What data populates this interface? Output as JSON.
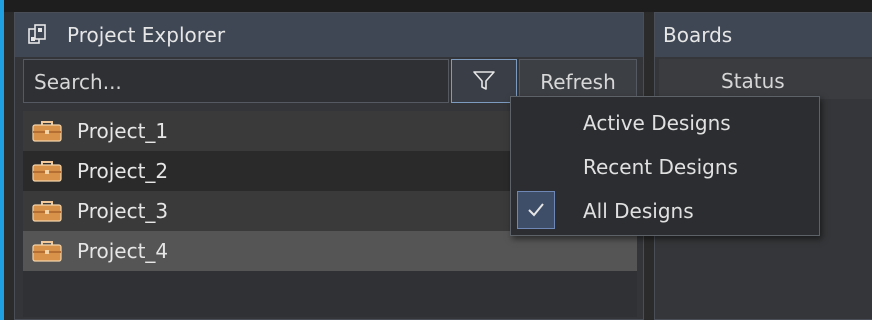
{
  "project_explorer": {
    "title": "Project Explorer",
    "search_placeholder": "Search...",
    "filter_icon": "filter-icon",
    "refresh_label": "Refresh",
    "projects": [
      {
        "label": "Project_1",
        "icon": "briefcase-icon"
      },
      {
        "label": "Project_2",
        "icon": "briefcase-icon"
      },
      {
        "label": "Project_3",
        "icon": "briefcase-icon"
      },
      {
        "label": "Project_4",
        "icon": "briefcase-icon",
        "selected": true
      }
    ]
  },
  "boards": {
    "title": "Boards",
    "columns": [
      "Status"
    ]
  },
  "filter_menu": {
    "items": [
      {
        "label": "Active Designs",
        "checked": false
      },
      {
        "label": "Recent Designs",
        "checked": false
      },
      {
        "label": "All Designs",
        "checked": true
      }
    ]
  },
  "colors": {
    "accent": "#1fa0e0",
    "title_bar": "#3f4755",
    "selected_row": "#555555",
    "briefcase": "#d9924a"
  }
}
